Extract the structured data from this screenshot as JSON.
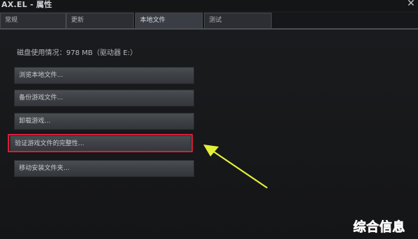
{
  "window": {
    "title": "AX.EL - 属性",
    "close_glyph": "✕"
  },
  "tabs": [
    {
      "label": "常规",
      "active": false
    },
    {
      "label": "更新",
      "active": false
    },
    {
      "label": "本地文件",
      "active": true
    },
    {
      "label": "测试",
      "active": false
    }
  ],
  "local_files": {
    "disk_usage": "磁盘使用情况：978 MB（驱动器 E:）",
    "buttons": [
      {
        "label": "浏览本地文件..."
      },
      {
        "label": "备份游戏文件..."
      },
      {
        "label": "卸载游戏..."
      },
      {
        "label": "验证游戏文件的完整性..."
      },
      {
        "label": "移动安装文件夹..."
      }
    ]
  },
  "annotation": {
    "highlight_color": "#d81f3a",
    "arrow_color": "#e3ee3a"
  },
  "watermark": {
    "text": "综合信息",
    "color": "#e5202f"
  }
}
